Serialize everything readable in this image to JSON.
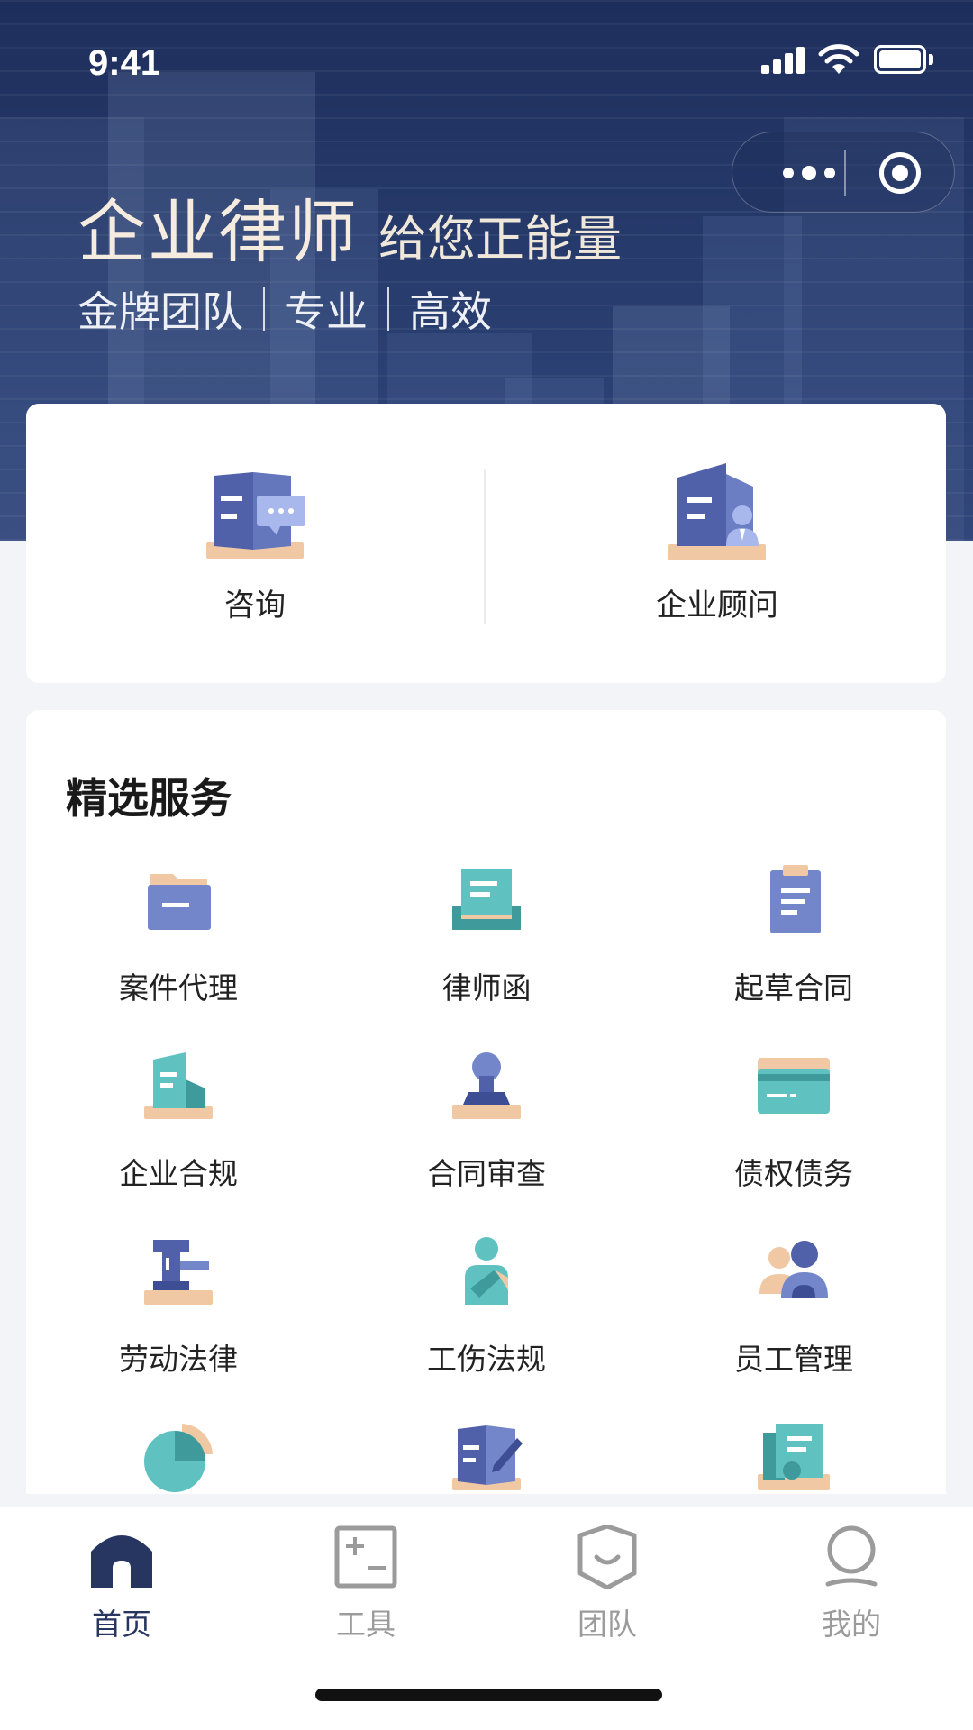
{
  "status_bar": {
    "time": "9:41"
  },
  "hero": {
    "title_main": "企业律师",
    "title_tag": "给您正能量",
    "subtitle_parts": [
      "金牌团队",
      "专业",
      "高效"
    ]
  },
  "top_actions": [
    {
      "label": "咨询",
      "icon": "consult-book-icon"
    },
    {
      "label": "企业顾问",
      "icon": "enterprise-advisor-icon"
    }
  ],
  "services": {
    "title": "精选服务",
    "items": [
      {
        "label": "案件代理",
        "icon": "folder-icon"
      },
      {
        "label": "律师函",
        "icon": "letter-tray-icon"
      },
      {
        "label": "起草合同",
        "icon": "clipboard-icon"
      },
      {
        "label": "企业合规",
        "icon": "building-icon"
      },
      {
        "label": "合同审查",
        "icon": "stamp-icon"
      },
      {
        "label": "债权债务",
        "icon": "card-icon"
      },
      {
        "label": "劳动法律",
        "icon": "gavel-icon"
      },
      {
        "label": "工伤法规",
        "icon": "injured-person-icon"
      },
      {
        "label": "员工管理",
        "icon": "people-icon"
      },
      {
        "label": "",
        "icon": "pie-chart-icon"
      },
      {
        "label": "",
        "icon": "book-edit-icon"
      },
      {
        "label": "",
        "icon": "documents-icon"
      }
    ]
  },
  "tabbar": {
    "active": "首页",
    "items": [
      {
        "label": "首页",
        "icon": "home-icon"
      },
      {
        "label": "工具",
        "icon": "tools-icon"
      },
      {
        "label": "团队",
        "icon": "shield-team-icon"
      },
      {
        "label": "我的",
        "icon": "user-icon"
      }
    ]
  },
  "colors": {
    "hero_dark": "#1e2e5c",
    "accent_blue": "#4c5fa8",
    "accent_teal": "#5fc2c0",
    "accent_peach": "#f0c9a4",
    "tab_active": "#273561",
    "tab_inactive": "#9b9b9b"
  }
}
